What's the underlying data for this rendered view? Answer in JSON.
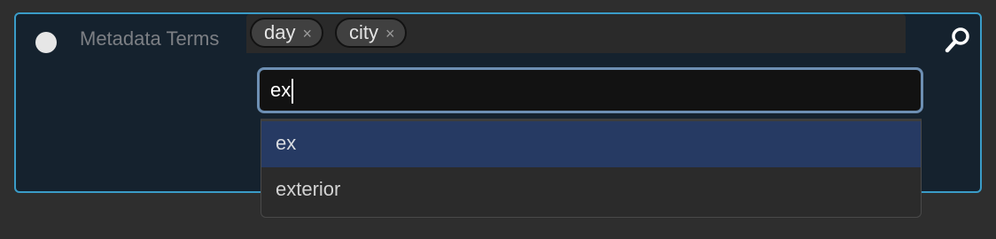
{
  "field": {
    "label": "Metadata Terms"
  },
  "tags": [
    {
      "label": "day",
      "remove_glyph": "×"
    },
    {
      "label": "city",
      "remove_glyph": "×"
    }
  ],
  "search": {
    "value": "ex"
  },
  "suggestions": [
    {
      "label": "ex",
      "highlighted": true
    },
    {
      "label": "exterior",
      "highlighted": false
    }
  ],
  "icons": {
    "radio": "radio-dot-icon",
    "search": "magnifier-icon",
    "remove": "close-icon"
  },
  "colors": {
    "panel_border": "#3a9cc8",
    "panel_bg": "#15222e",
    "highlight": "#263a63",
    "focus_ring": "#6d8fb3"
  }
}
